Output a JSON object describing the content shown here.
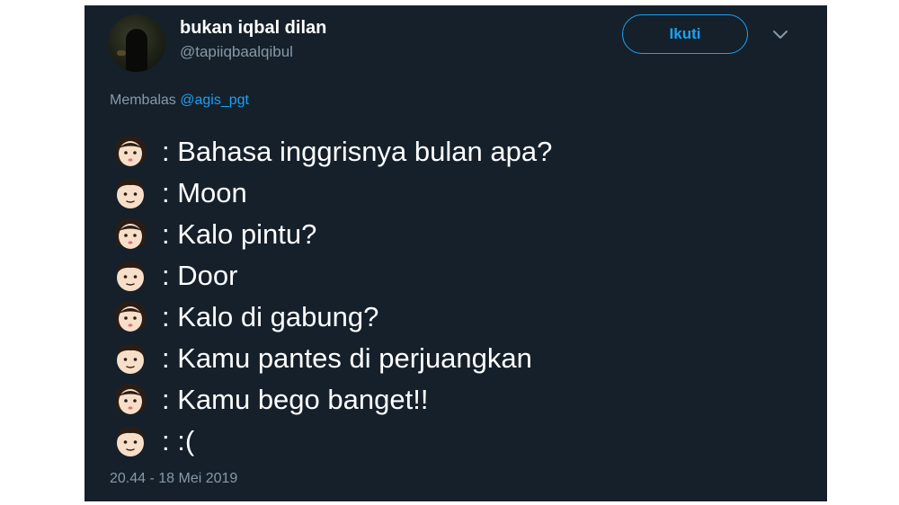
{
  "user": {
    "display_name": "bukan iqbal dilan",
    "handle": "@tapiiqbaalqibul"
  },
  "follow_button": {
    "label": "Ikuti"
  },
  "reply": {
    "prefix": "Membalas",
    "mention": "@agis_pgt"
  },
  "lines": [
    {
      "emoji": "woman-face-icon",
      "text": ": Bahasa inggrisnya bulan apa?"
    },
    {
      "emoji": "man-face-icon",
      "text": ": Moon"
    },
    {
      "emoji": "woman-face-icon",
      "text": ": Kalo pintu?"
    },
    {
      "emoji": "man-face-icon",
      "text": ": Door"
    },
    {
      "emoji": "woman-face-icon",
      "text": ": Kalo di gabung?"
    },
    {
      "emoji": "man-face-icon",
      "text": ": Kamu pantes di perjuangkan"
    },
    {
      "emoji": "woman-face-icon",
      "text": ": Kamu bego banget!!"
    },
    {
      "emoji": "man-face-icon",
      "text": ": :("
    }
  ],
  "timestamp": "20.44 - 18 Mei 2019",
  "colors": {
    "background": "#15202b",
    "text": "#ffffff",
    "secondary_text": "#8899a6",
    "accent": "#1da1f2"
  }
}
